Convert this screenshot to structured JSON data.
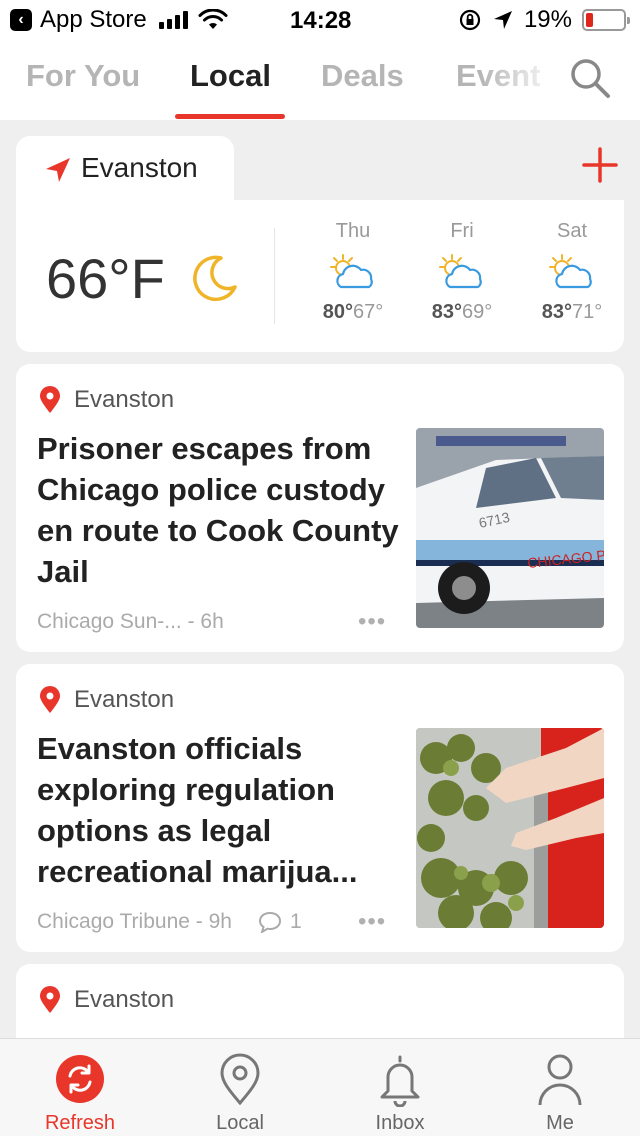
{
  "status_bar": {
    "back_app": "App Store",
    "time": "14:28",
    "battery": "19%",
    "battery_level": 0.19
  },
  "tabs": [
    {
      "label": "For You",
      "active": false
    },
    {
      "label": "Local",
      "active": true
    },
    {
      "label": "Deals",
      "active": false
    },
    {
      "label": "Event",
      "active": false
    }
  ],
  "weather": {
    "location": "Evanston",
    "current_temp": "66°F",
    "current_icon": "moon-icon",
    "forecast": [
      {
        "day": "Thu",
        "high": "80°",
        "low": "67°",
        "icon": "partly-sunny-icon"
      },
      {
        "day": "Fri",
        "high": "83°",
        "low": "69°",
        "icon": "partly-sunny-icon"
      },
      {
        "day": "Sat",
        "high": "83°",
        "low": "71°",
        "icon": "partly-sunny-icon"
      }
    ]
  },
  "news": [
    {
      "location": "Evanston",
      "headline": "Prisoner escapes from Chicago police custody en route to Cook County Jail",
      "source": "Chicago Sun-... - 6h",
      "more": "•••",
      "thumbnail": "police-car-photo"
    },
    {
      "location": "Evanston",
      "headline": "Evanston officials exploring regulation options as legal recreational marijua...",
      "source": "Chicago Tribune - 9h",
      "comments": "1",
      "more": "•••",
      "thumbnail": "marijuana-photo"
    },
    {
      "location": "Evanston"
    }
  ],
  "bottom_nav": [
    {
      "label": "Refresh",
      "icon": "refresh-icon",
      "active": true
    },
    {
      "label": "Local",
      "icon": "location-pin-icon",
      "active": false
    },
    {
      "label": "Inbox",
      "icon": "bell-icon",
      "active": false
    },
    {
      "label": "Me",
      "icon": "person-icon",
      "active": false
    }
  ],
  "colors": {
    "accent": "#e8362a",
    "background": "#efefef"
  }
}
